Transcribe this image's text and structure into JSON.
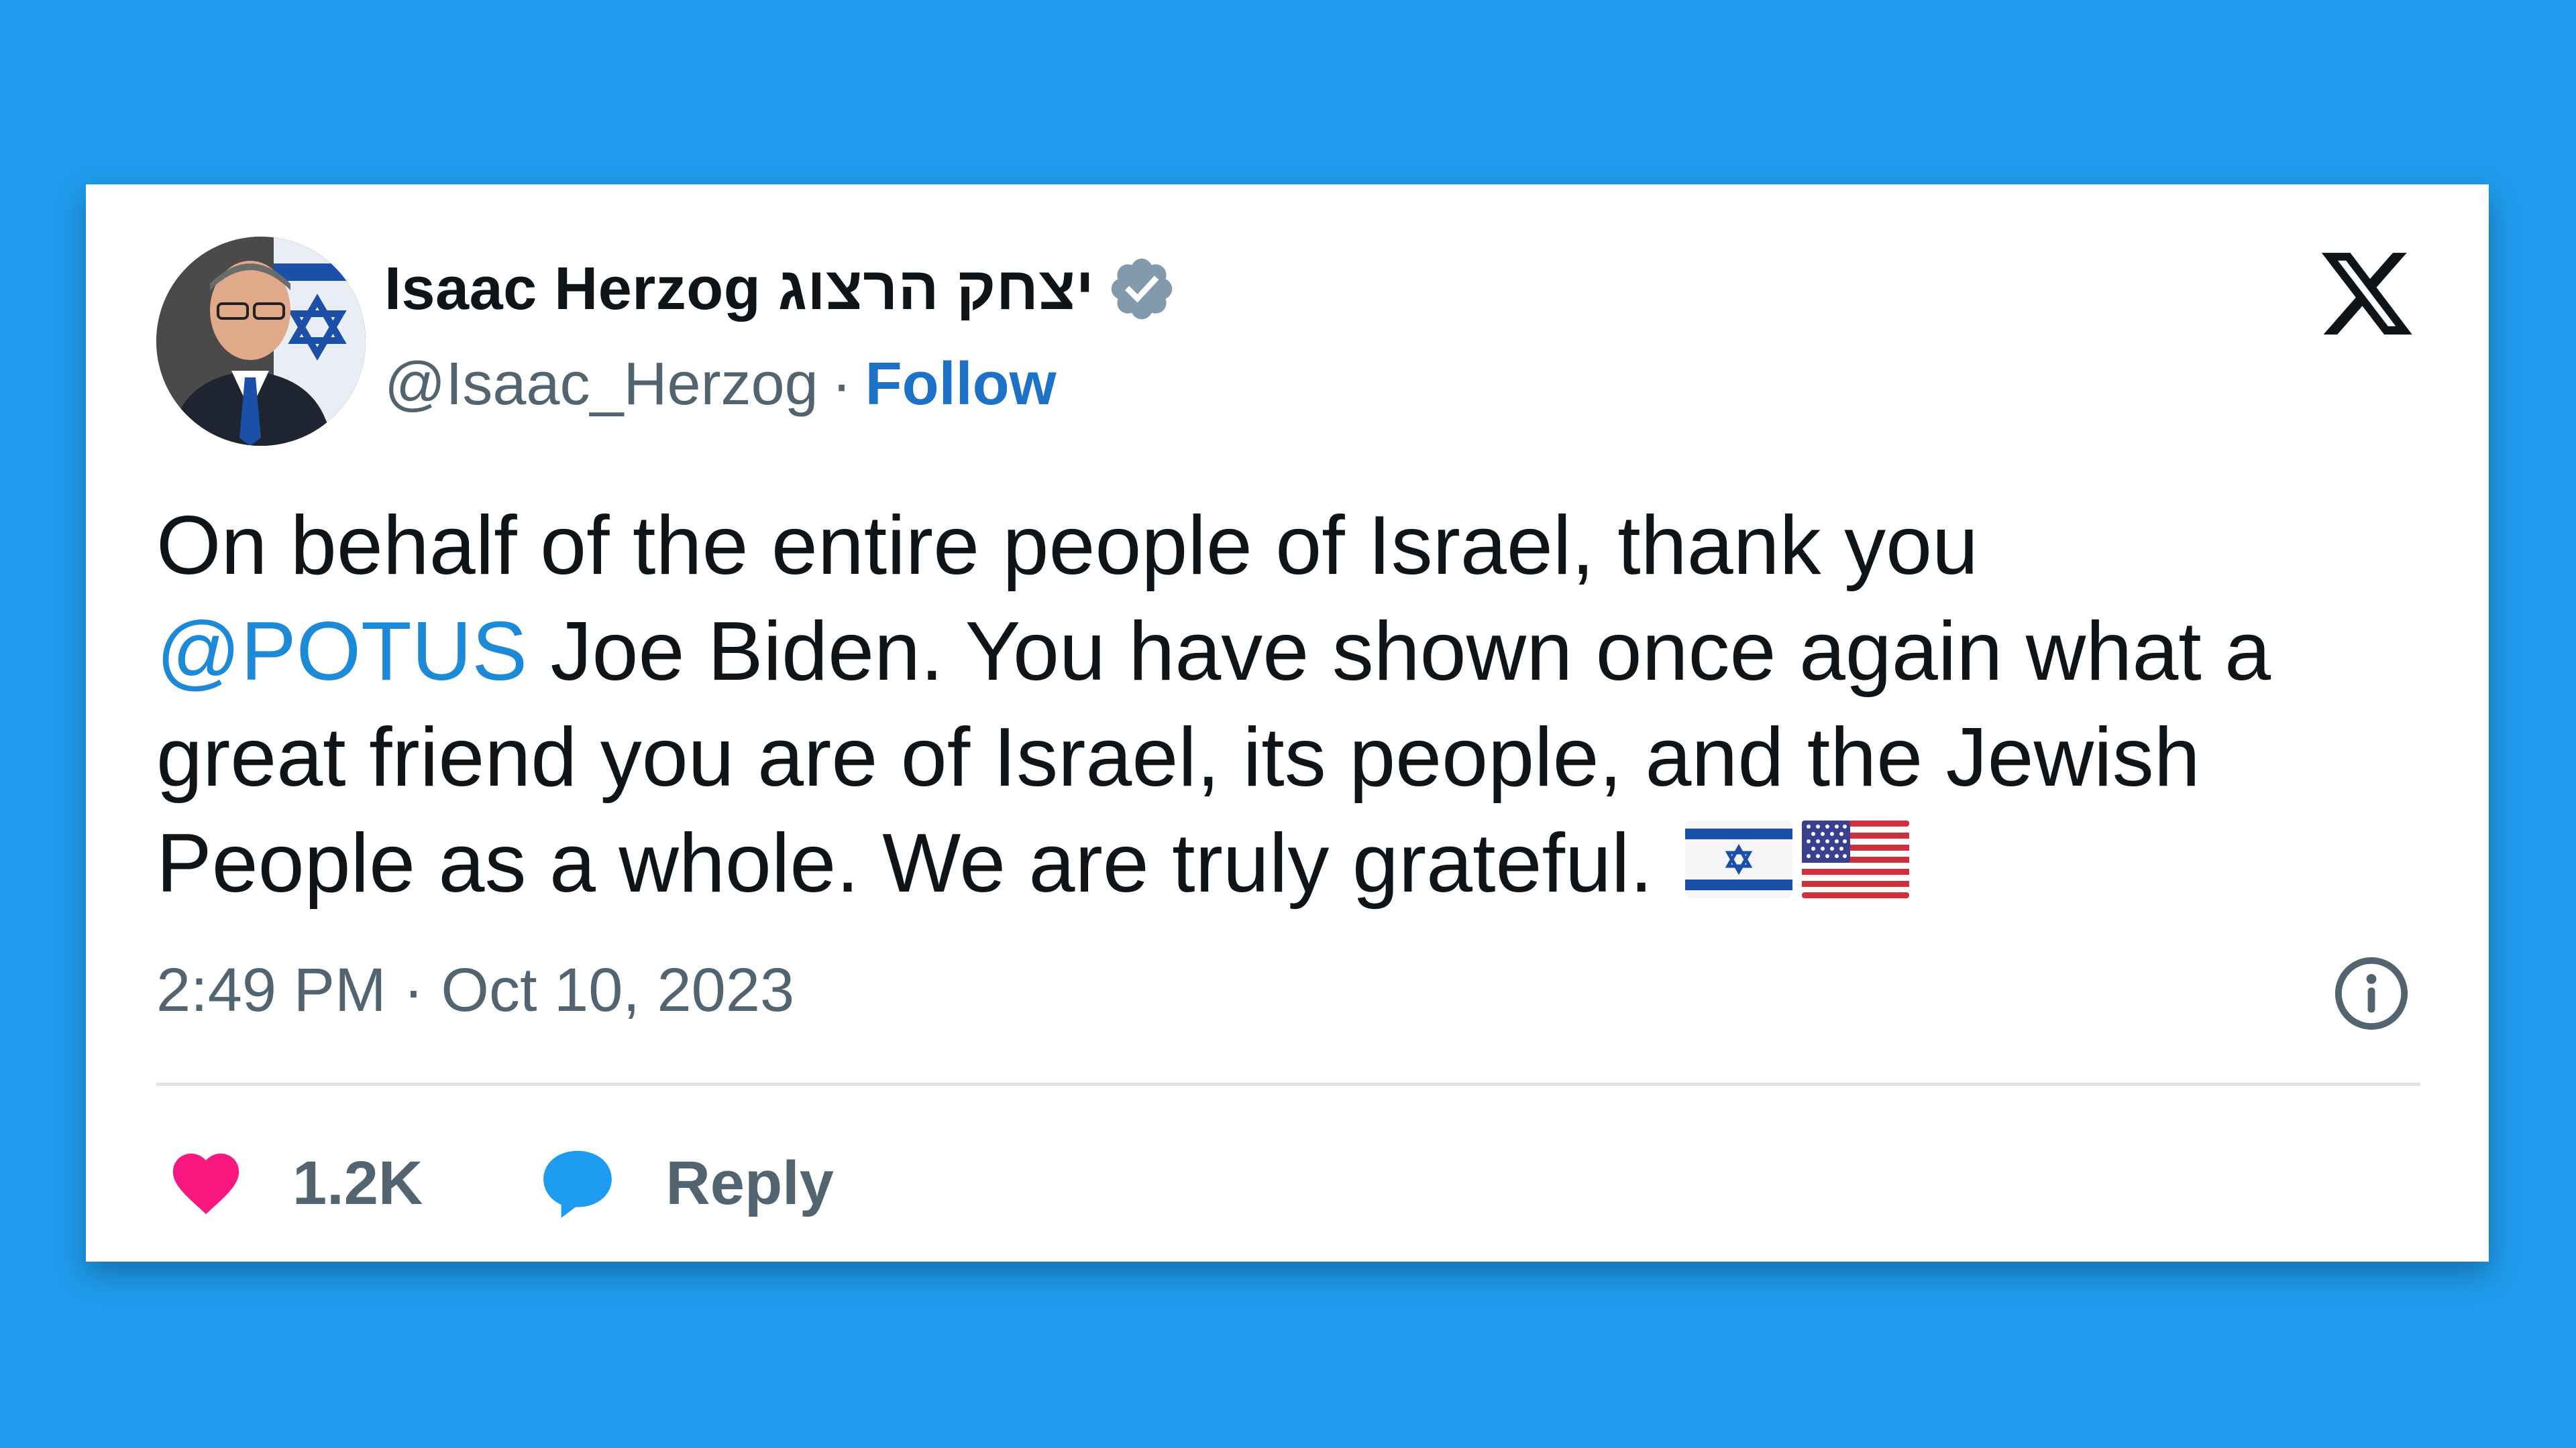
{
  "tweet": {
    "author": {
      "display_name": "Isaac Herzog יצחק הרצוג",
      "handle": "@Isaac_Herzog",
      "separator": "·",
      "follow_label": "Follow",
      "verified_color": "#829aab"
    },
    "text": {
      "line1": "On behalf of the entire people of Israel, thank you",
      "mention": "@POTUS",
      "line2_rest": " Joe Biden. You have shown once again what a",
      "line3": "great friend you are of Israel, its people, and the Jewish",
      "line4": "People as a whole. We are truly grateful. "
    },
    "flags": [
      "flag-israel-icon",
      "flag-usa-icon"
    ],
    "timestamp": "2:49 PM · Oct 10, 2023",
    "actions": {
      "like_count": "1.2K",
      "reply_label": "Reply"
    },
    "colors": {
      "background": "#1f9bed",
      "like": "#f91880",
      "reply": "#1d9bf0",
      "link": "#1d72c7"
    }
  }
}
